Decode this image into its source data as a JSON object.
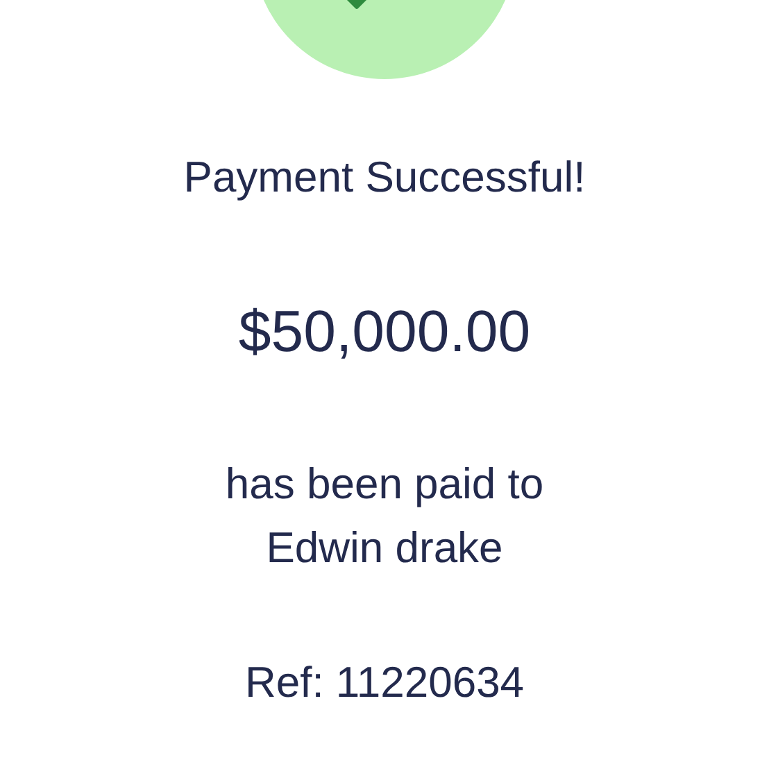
{
  "title": "Payment Successful!",
  "amount": "$50,000.00",
  "message_lines": [
    "has been paid to",
    "Edwin drake"
  ],
  "reference": "Ref: 11220634"
}
